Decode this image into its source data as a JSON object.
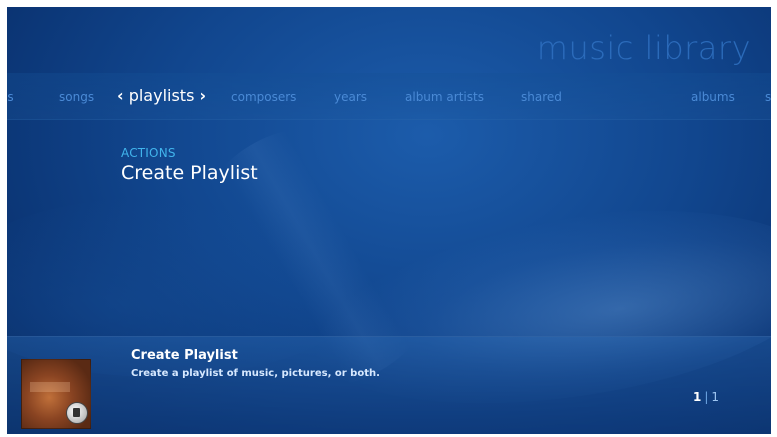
{
  "app": {
    "title": "music library"
  },
  "nav": {
    "items": [
      {
        "label": "es",
        "name": "nav-item-partial-left"
      },
      {
        "label": "songs",
        "name": "nav-item-songs"
      },
      {
        "label": "composers",
        "name": "nav-item-composers"
      },
      {
        "label": "years",
        "name": "nav-item-years"
      },
      {
        "label": "album artists",
        "name": "nav-item-album-artists"
      },
      {
        "label": "shared",
        "name": "nav-item-shared"
      },
      {
        "label": "albums",
        "name": "nav-item-albums"
      },
      {
        "label": "s",
        "name": "nav-item-partial-right"
      }
    ],
    "selected": {
      "label": "playlists",
      "left_chevron": "‹",
      "right_chevron": "›"
    }
  },
  "section": {
    "label": "ACTIONS",
    "item": "Create Playlist"
  },
  "details": {
    "title": "Create Playlist",
    "description": "Create a playlist of music, pictures, or both."
  },
  "pager": {
    "current": "1",
    "separator": "|",
    "total": "1"
  },
  "colors": {
    "background": "#11468e",
    "nav_inactive": "#4a8ad6",
    "section_label": "#41b4ec",
    "title": "#2e6fbf"
  }
}
